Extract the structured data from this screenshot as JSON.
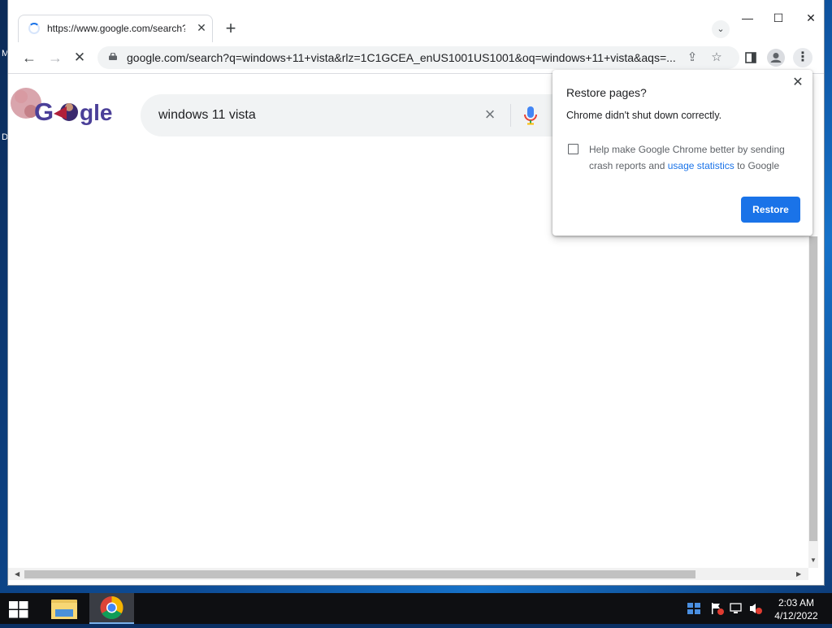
{
  "browser": {
    "tab": {
      "title": "https://www.google.com/search?q"
    },
    "window_controls": {
      "minimize": "—",
      "maximize": "☐",
      "close": "✕"
    },
    "address_bar": {
      "url": "google.com/search?q=windows+11+vista&rlz=1C1GCEA_enUS1001US1001&oq=windows+11+vista&aqs=..."
    }
  },
  "page": {
    "search_query": "windows 11 vista",
    "logo_text": "Google"
  },
  "restore_popup": {
    "title": "Restore pages?",
    "message": "Chrome didn't shut down correctly.",
    "checkbox_text_before": "Help make Google Chrome better by sending crash reports and ",
    "checkbox_link": "usage statistics",
    "checkbox_text_after": " to Google",
    "checkbox_checked": false,
    "restore_button": "Restore"
  },
  "taskbar": {
    "time": "2:03 AM",
    "date": "4/12/2022"
  },
  "desktop_labels": [
    "M",
    "D"
  ],
  "colors": {
    "accent": "#1a73e8",
    "desktop_blue": "#0d4c96",
    "taskbar": "#0e0f12"
  }
}
